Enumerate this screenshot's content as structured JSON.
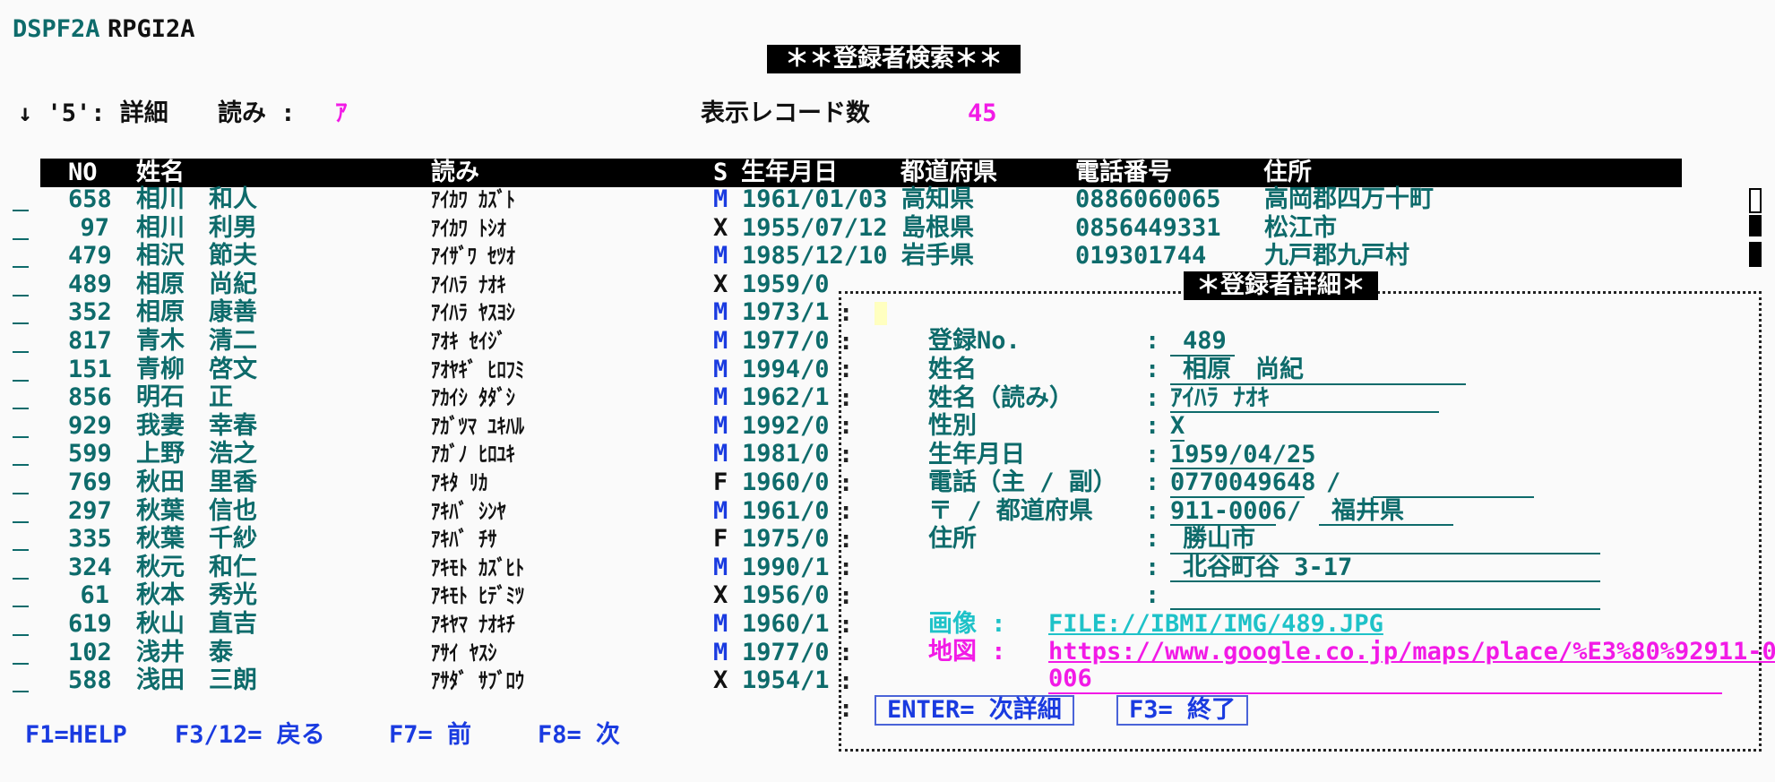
{
  "header": {
    "program_a": "DSPF2A",
    "program_b": "RPGI2A",
    "title": "＊＊登録者検索＊＊"
  },
  "info": {
    "option_hint": "↓ '5': 詳細",
    "reading_label": "読み :",
    "reading_value": "ｱ",
    "count_label": "表示レコード数",
    "count_value": "45"
  },
  "columns": [
    "NO",
    "姓名",
    "読み",
    "S",
    "生年月日",
    "都道府県",
    "電話番号",
    "住所"
  ],
  "rows": [
    {
      "no": "658",
      "name": "相川　和人",
      "kana": "ｱｲｶﾜ ｶｽﾞﾄ",
      "s": "M",
      "birth": "1961/01/03",
      "pref": "高知県",
      "tel": "0886060065",
      "addr": "高岡郡四万十町"
    },
    {
      "no": "97",
      "name": "相川　利男",
      "kana": "ｱｲｶﾜ ﾄｼｵ",
      "s": "X",
      "birth": "1955/07/12",
      "pref": "島根県",
      "tel": "0856449331",
      "addr": "松江市"
    },
    {
      "no": "479",
      "name": "相沢　節夫",
      "kana": "ｱｲｻﾞﾜ ｾﾂｵ",
      "s": "M",
      "birth": "1985/12/10",
      "pref": "岩手県",
      "tel": "019301744",
      "addr": "九戸郡九戸村"
    },
    {
      "no": "489",
      "name": "相原　尚紀",
      "kana": "ｱｲﾊﾗ ﾅｵｷ",
      "s": "X",
      "birth": "1959/0",
      "pref": "",
      "tel": "",
      "addr": ""
    },
    {
      "no": "352",
      "name": "相原　康善",
      "kana": "ｱｲﾊﾗ ﾔｽﾖｼ",
      "s": "M",
      "birth": "1973/1",
      "pref": "",
      "tel": "",
      "addr": ""
    },
    {
      "no": "817",
      "name": "青木　清二",
      "kana": "ｱｵｷ ｾｲｼﾞ",
      "s": "M",
      "birth": "1977/0",
      "pref": "",
      "tel": "",
      "addr": ""
    },
    {
      "no": "151",
      "name": "青柳　啓文",
      "kana": "ｱｵﾔｷﾞ ﾋﾛﾌﾐ",
      "s": "M",
      "birth": "1994/0",
      "pref": "",
      "tel": "",
      "addr": ""
    },
    {
      "no": "856",
      "name": "明石　正",
      "kana": "ｱｶｲｼ ﾀﾀﾞｼ",
      "s": "M",
      "birth": "1962/1",
      "pref": "",
      "tel": "",
      "addr": ""
    },
    {
      "no": "929",
      "name": "我妻　幸春",
      "kana": "ｱｶﾞﾂﾏ ﾕｷﾊﾙ",
      "s": "M",
      "birth": "1992/0",
      "pref": "",
      "tel": "",
      "addr": ""
    },
    {
      "no": "599",
      "name": "上野　浩之",
      "kana": "ｱｶﾞﾉ ﾋﾛﾕｷ",
      "s": "M",
      "birth": "1981/0",
      "pref": "",
      "tel": "",
      "addr": ""
    },
    {
      "no": "769",
      "name": "秋田　里香",
      "kana": "ｱｷﾀ ﾘｶ",
      "s": "F",
      "birth": "1960/0",
      "pref": "",
      "tel": "",
      "addr": ""
    },
    {
      "no": "297",
      "name": "秋葉　信也",
      "kana": "ｱｷﾊﾞ ｼﾝﾔ",
      "s": "M",
      "birth": "1961/0",
      "pref": "",
      "tel": "",
      "addr": ""
    },
    {
      "no": "335",
      "name": "秋葉　千紗",
      "kana": "ｱｷﾊﾞ ﾁｻ",
      "s": "F",
      "birth": "1975/0",
      "pref": "",
      "tel": "",
      "addr": ""
    },
    {
      "no": "324",
      "name": "秋元　和仁",
      "kana": "ｱｷﾓﾄ ｶｽﾞﾋﾄ",
      "s": "M",
      "birth": "1990/1",
      "pref": "",
      "tel": "",
      "addr": ""
    },
    {
      "no": "61",
      "name": "秋本　秀光",
      "kana": "ｱｷﾓﾄ ﾋﾃﾞﾐﾂ",
      "s": "X",
      "birth": "1956/0",
      "pref": "",
      "tel": "",
      "addr": ""
    },
    {
      "no": "619",
      "name": "秋山　直吉",
      "kana": "ｱｷﾔﾏ ﾅｵｷﾁ",
      "s": "M",
      "birth": "1960/1",
      "pref": "",
      "tel": "",
      "addr": ""
    },
    {
      "no": "102",
      "name": "浅井　泰",
      "kana": "ｱｻｲ ﾔｽｼ",
      "s": "M",
      "birth": "1977/0",
      "pref": "",
      "tel": "",
      "addr": ""
    },
    {
      "no": "588",
      "name": "浅田　三朗",
      "kana": "ｱｻﾀﾞ ｻﾌﾞﾛｳ",
      "s": "X",
      "birth": "1954/1",
      "pref": "",
      "tel": "",
      "addr": ""
    }
  ],
  "footer": {
    "f1": "F1=HELP",
    "f3": "F3/12= 戻る",
    "f7": "F7= 前",
    "f8": "F8= 次"
  },
  "detail": {
    "title": "＊登録者詳細＊",
    "labels": {
      "no": "登録No.",
      "name": "姓名",
      "kana": "姓名（読み）",
      "sex": "性別",
      "birth": "生年月日",
      "tel": "電話（主 / 副）",
      "zip": "〒 / 都道府県",
      "addr": "住所"
    },
    "colon": ":",
    "values": {
      "no": "489",
      "name": "相原　尚紀",
      "kana": "ｱｲﾊﾗ ﾅｵｷ",
      "sex": "X",
      "birth": "1959/04/25",
      "tel_main": "0770049648",
      "tel_sep": "/",
      "tel_sub": "",
      "zip": "911-0006",
      "zip_sep": "/",
      "pref": "福井県",
      "addr1": "勝山市",
      "addr2": "北谷町谷 3-17",
      "addr3": ""
    },
    "image_label": "画像 :",
    "image_value": "FILE://IBMI/IMG/489.JPG",
    "map_label": "地図 :",
    "map_value_1": "https://www.google.co.jp/maps/place/%E3%80%92911-0",
    "map_value_2": "006",
    "btn_enter": "ENTER= 次詳細",
    "btn_f3": "F3= 終了"
  },
  "colors": {
    "teal": "#0e6b6b",
    "magenta": "#f21ae6",
    "blue": "#1a3be0",
    "cyan": "#1ec2c8"
  }
}
